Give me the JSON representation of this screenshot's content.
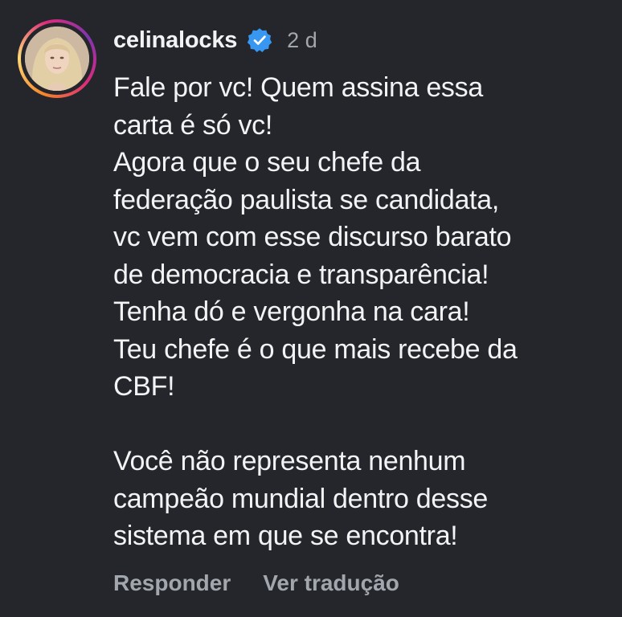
{
  "comment": {
    "username": "celinalocks",
    "verified_icon": "verified-badge-icon",
    "time_ago": "2 d",
    "lines_part1": [
      "Fale por vc! Quem assina essa",
      "carta é só vc!",
      "Agora que o seu chefe da",
      "federação paulista se candidata,",
      "vc vem com esse discurso barato",
      "de democracia e transparência!",
      "Tenha dó e vergonha na cara!",
      "Teu chefe é o que mais recebe da",
      "CBF!"
    ],
    "lines_part2": [
      "Você não representa nenhum",
      "campeão mundial dentro desse",
      "sistema em que se encontra!"
    ],
    "actions": {
      "reply": "Responder",
      "translate": "Ver tradução"
    }
  },
  "colors": {
    "background": "#24262b",
    "text": "#f2f3f5",
    "muted": "#a2a6ad",
    "verified": "#3897f0"
  }
}
